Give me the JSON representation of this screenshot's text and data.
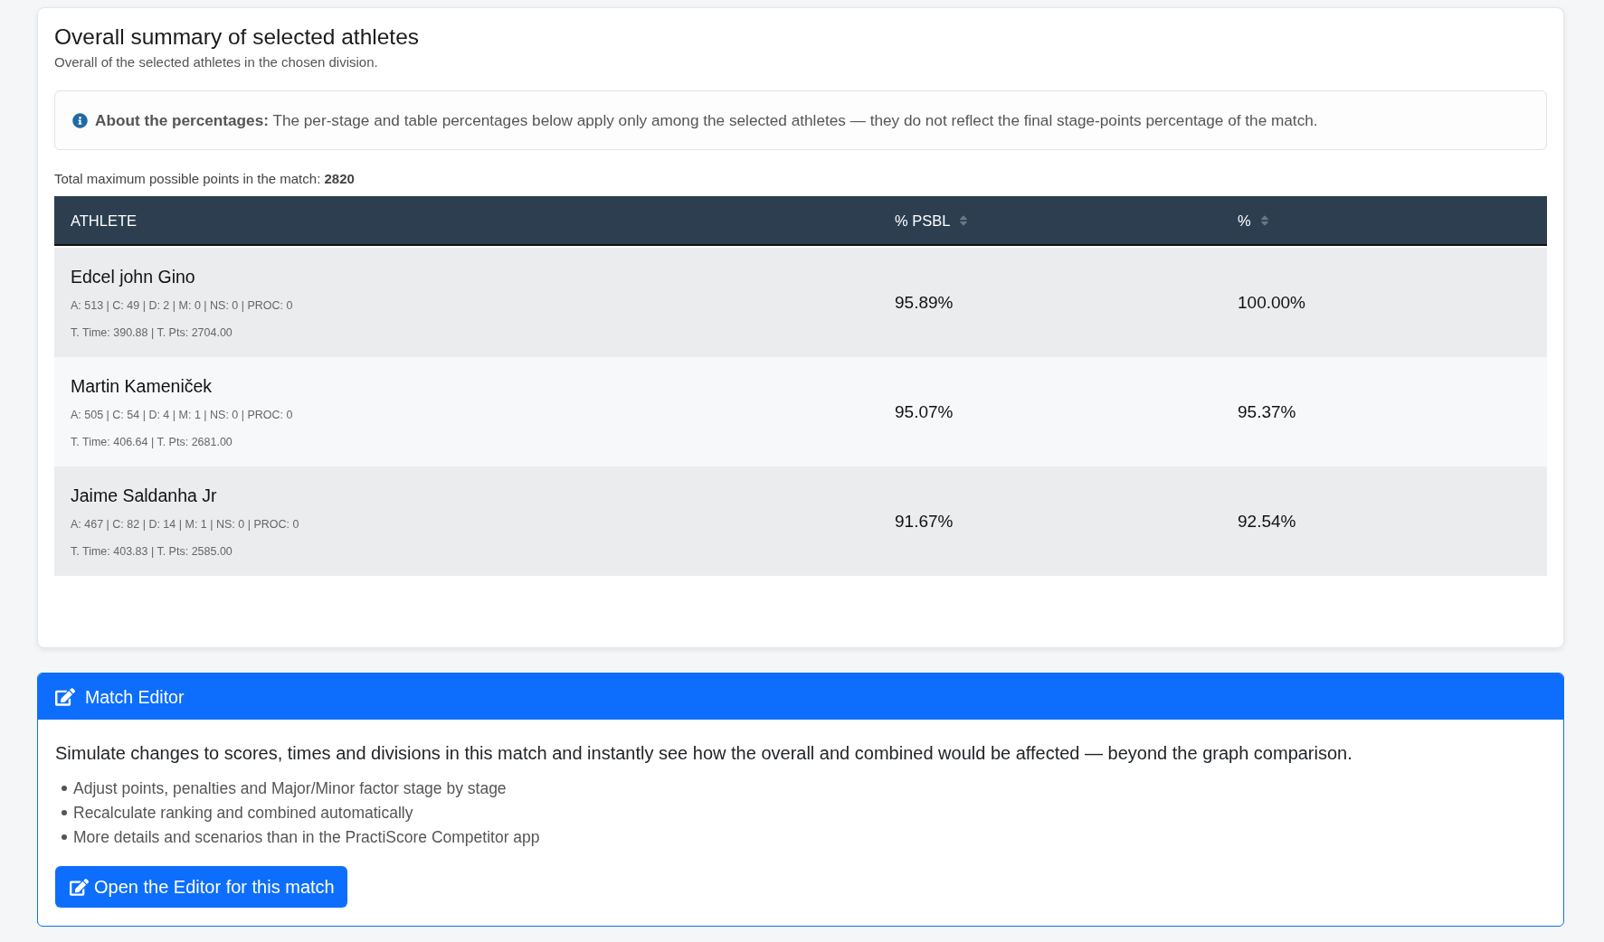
{
  "summary": {
    "title": "Overall summary of selected athletes",
    "subtitle": "Overall of the selected athletes in the chosen division.",
    "info": "**About the percentages:** The per-stage and table percentages below apply only among the selected athletes — they do not reflect the final stage-points percentage of the match.",
    "total": "Total maximum possible points in the match: **2820**",
    "table": {
      "columns": [
        {
          "label": "ATHLETE",
          "sortable": false
        },
        {
          "label": "% PSBL",
          "sortable": true
        },
        {
          "label": "%",
          "sortable": true
        }
      ],
      "rows": [
        {
          "cells": [
            {
              "name": "Edcel john Gino",
              "stats": [
                "A: 513 | C: 49 | D: 2 | M: 0 | NS: 0 | PROC: 0",
                "T. Time: 390.88 | T. Pts: 2704.00"
              ]
            },
            "95.89%",
            "100.00%"
          ]
        },
        {
          "cells": [
            {
              "name": "Martin Kameniček",
              "stats": [
                "A: 505 | C: 54 | D: 4 | M: 1 | NS: 0 | PROC: 0",
                "T. Time: 406.64 | T. Pts: 2681.00"
              ]
            },
            "95.07%",
            "95.37%"
          ]
        },
        {
          "cells": [
            {
              "name": "Jaime Saldanha Jr",
              "stats": [
                "A: 467 | C: 82 | D: 14 | M: 1 | NS: 0 | PROC: 0",
                "T. Time: 403.83 | T. Pts: 2585.00"
              ]
            },
            "91.67%",
            "92.54%"
          ]
        }
      ]
    }
  },
  "match_editor": {
    "title": "Match Editor",
    "description": "Simulate changes to scores, times and divisions in this match and instantly see how the overall and combined would be affected — beyond the graph comparison.",
    "bullets": [
      "Adjust points, penalties and Major/Minor factor stage by stage",
      "Recalculate ranking and combined automatically",
      "More details and scenarios than in the PractiScore Competitor app"
    ],
    "button": "Open the Editor for this match"
  }
}
